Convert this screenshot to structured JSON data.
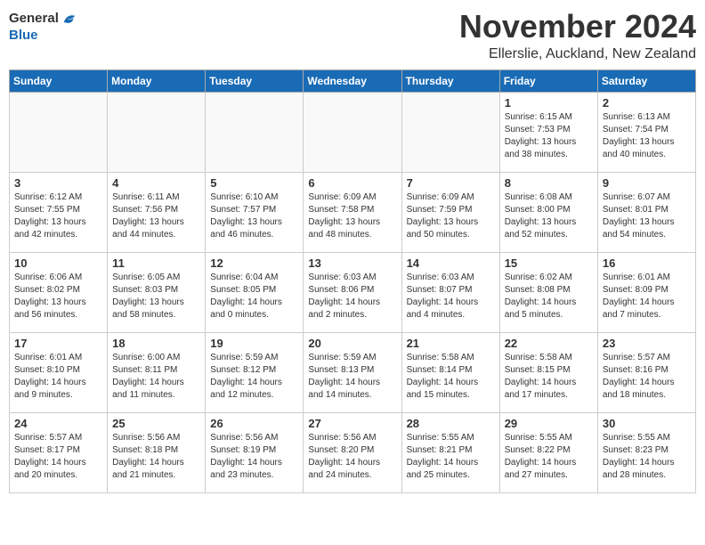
{
  "header": {
    "logo_general": "General",
    "logo_blue": "Blue",
    "month_title": "November 2024",
    "location": "Ellerslie, Auckland, New Zealand"
  },
  "weekdays": [
    "Sunday",
    "Monday",
    "Tuesday",
    "Wednesday",
    "Thursday",
    "Friday",
    "Saturday"
  ],
  "weeks": [
    [
      {
        "day": "",
        "info": ""
      },
      {
        "day": "",
        "info": ""
      },
      {
        "day": "",
        "info": ""
      },
      {
        "day": "",
        "info": ""
      },
      {
        "day": "",
        "info": ""
      },
      {
        "day": "1",
        "info": "Sunrise: 6:15 AM\nSunset: 7:53 PM\nDaylight: 13 hours\nand 38 minutes."
      },
      {
        "day": "2",
        "info": "Sunrise: 6:13 AM\nSunset: 7:54 PM\nDaylight: 13 hours\nand 40 minutes."
      }
    ],
    [
      {
        "day": "3",
        "info": "Sunrise: 6:12 AM\nSunset: 7:55 PM\nDaylight: 13 hours\nand 42 minutes."
      },
      {
        "day": "4",
        "info": "Sunrise: 6:11 AM\nSunset: 7:56 PM\nDaylight: 13 hours\nand 44 minutes."
      },
      {
        "day": "5",
        "info": "Sunrise: 6:10 AM\nSunset: 7:57 PM\nDaylight: 13 hours\nand 46 minutes."
      },
      {
        "day": "6",
        "info": "Sunrise: 6:09 AM\nSunset: 7:58 PM\nDaylight: 13 hours\nand 48 minutes."
      },
      {
        "day": "7",
        "info": "Sunrise: 6:09 AM\nSunset: 7:59 PM\nDaylight: 13 hours\nand 50 minutes."
      },
      {
        "day": "8",
        "info": "Sunrise: 6:08 AM\nSunset: 8:00 PM\nDaylight: 13 hours\nand 52 minutes."
      },
      {
        "day": "9",
        "info": "Sunrise: 6:07 AM\nSunset: 8:01 PM\nDaylight: 13 hours\nand 54 minutes."
      }
    ],
    [
      {
        "day": "10",
        "info": "Sunrise: 6:06 AM\nSunset: 8:02 PM\nDaylight: 13 hours\nand 56 minutes."
      },
      {
        "day": "11",
        "info": "Sunrise: 6:05 AM\nSunset: 8:03 PM\nDaylight: 13 hours\nand 58 minutes."
      },
      {
        "day": "12",
        "info": "Sunrise: 6:04 AM\nSunset: 8:05 PM\nDaylight: 14 hours\nand 0 minutes."
      },
      {
        "day": "13",
        "info": "Sunrise: 6:03 AM\nSunset: 8:06 PM\nDaylight: 14 hours\nand 2 minutes."
      },
      {
        "day": "14",
        "info": "Sunrise: 6:03 AM\nSunset: 8:07 PM\nDaylight: 14 hours\nand 4 minutes."
      },
      {
        "day": "15",
        "info": "Sunrise: 6:02 AM\nSunset: 8:08 PM\nDaylight: 14 hours\nand 5 minutes."
      },
      {
        "day": "16",
        "info": "Sunrise: 6:01 AM\nSunset: 8:09 PM\nDaylight: 14 hours\nand 7 minutes."
      }
    ],
    [
      {
        "day": "17",
        "info": "Sunrise: 6:01 AM\nSunset: 8:10 PM\nDaylight: 14 hours\nand 9 minutes."
      },
      {
        "day": "18",
        "info": "Sunrise: 6:00 AM\nSunset: 8:11 PM\nDaylight: 14 hours\nand 11 minutes."
      },
      {
        "day": "19",
        "info": "Sunrise: 5:59 AM\nSunset: 8:12 PM\nDaylight: 14 hours\nand 12 minutes."
      },
      {
        "day": "20",
        "info": "Sunrise: 5:59 AM\nSunset: 8:13 PM\nDaylight: 14 hours\nand 14 minutes."
      },
      {
        "day": "21",
        "info": "Sunrise: 5:58 AM\nSunset: 8:14 PM\nDaylight: 14 hours\nand 15 minutes."
      },
      {
        "day": "22",
        "info": "Sunrise: 5:58 AM\nSunset: 8:15 PM\nDaylight: 14 hours\nand 17 minutes."
      },
      {
        "day": "23",
        "info": "Sunrise: 5:57 AM\nSunset: 8:16 PM\nDaylight: 14 hours\nand 18 minutes."
      }
    ],
    [
      {
        "day": "24",
        "info": "Sunrise: 5:57 AM\nSunset: 8:17 PM\nDaylight: 14 hours\nand 20 minutes."
      },
      {
        "day": "25",
        "info": "Sunrise: 5:56 AM\nSunset: 8:18 PM\nDaylight: 14 hours\nand 21 minutes."
      },
      {
        "day": "26",
        "info": "Sunrise: 5:56 AM\nSunset: 8:19 PM\nDaylight: 14 hours\nand 23 minutes."
      },
      {
        "day": "27",
        "info": "Sunrise: 5:56 AM\nSunset: 8:20 PM\nDaylight: 14 hours\nand 24 minutes."
      },
      {
        "day": "28",
        "info": "Sunrise: 5:55 AM\nSunset: 8:21 PM\nDaylight: 14 hours\nand 25 minutes."
      },
      {
        "day": "29",
        "info": "Sunrise: 5:55 AM\nSunset: 8:22 PM\nDaylight: 14 hours\nand 27 minutes."
      },
      {
        "day": "30",
        "info": "Sunrise: 5:55 AM\nSunset: 8:23 PM\nDaylight: 14 hours\nand 28 minutes."
      }
    ]
  ]
}
